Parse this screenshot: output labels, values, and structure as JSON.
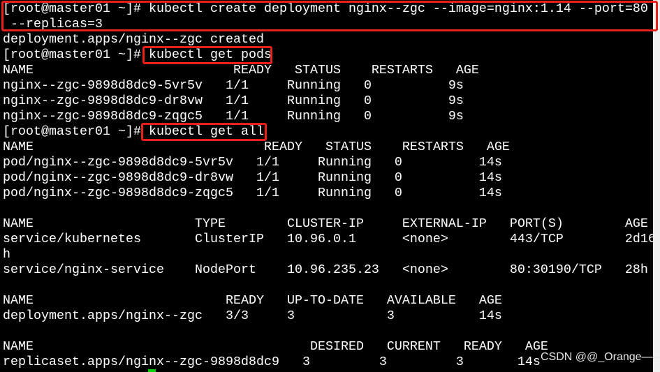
{
  "lines": [
    "[root@master01 ~]# kubectl create deployment nginx--zgc --image=nginx:1.14 --port=80",
    " --replicas=3",
    "deployment.apps/nginx--zgc created",
    "[root@master01 ~]# kubectl get pods",
    "NAME                          READY   STATUS    RESTARTS   AGE",
    "nginx--zgc-9898d8dc9-5vr5v   1/1     Running   0          9s",
    "nginx--zgc-9898d8dc9-dr8vw   1/1     Running   0          9s",
    "nginx--zgc-9898d8dc9-zqgc5   1/1     Running   0          9s",
    "[root@master01 ~]# kubectl get all",
    "NAME                              READY   STATUS    RESTARTS   AGE",
    "pod/nginx--zgc-9898d8dc9-5vr5v   1/1     Running   0          14s",
    "pod/nginx--zgc-9898d8dc9-dr8vw   1/1     Running   0          14s",
    "pod/nginx--zgc-9898d8dc9-zqgc5   1/1     Running   0          14s",
    "",
    "NAME                     TYPE        CLUSTER-IP     EXTERNAL-IP   PORT(S)        AGE",
    "service/kubernetes       ClusterIP   10.96.0.1      <none>        443/TCP        2d16",
    "h",
    "service/nginx-service    NodePort    10.96.235.23   <none>        80:30190/TCP   28h",
    "",
    "NAME                         READY   UP-TO-DATE   AVAILABLE   AGE",
    "deployment.apps/nginx--zgc   3/3     3            3           14s",
    "",
    "NAME                                    DESIRED   CURRENT   READY   AGE",
    "replicaset.apps/nginx--zgc-9898d8dc9   3         3         3       14s"
  ],
  "watermark": "CSDN @@_Orange——",
  "colors": {
    "highlight": "#e8201a",
    "cursor": "#00d000"
  }
}
